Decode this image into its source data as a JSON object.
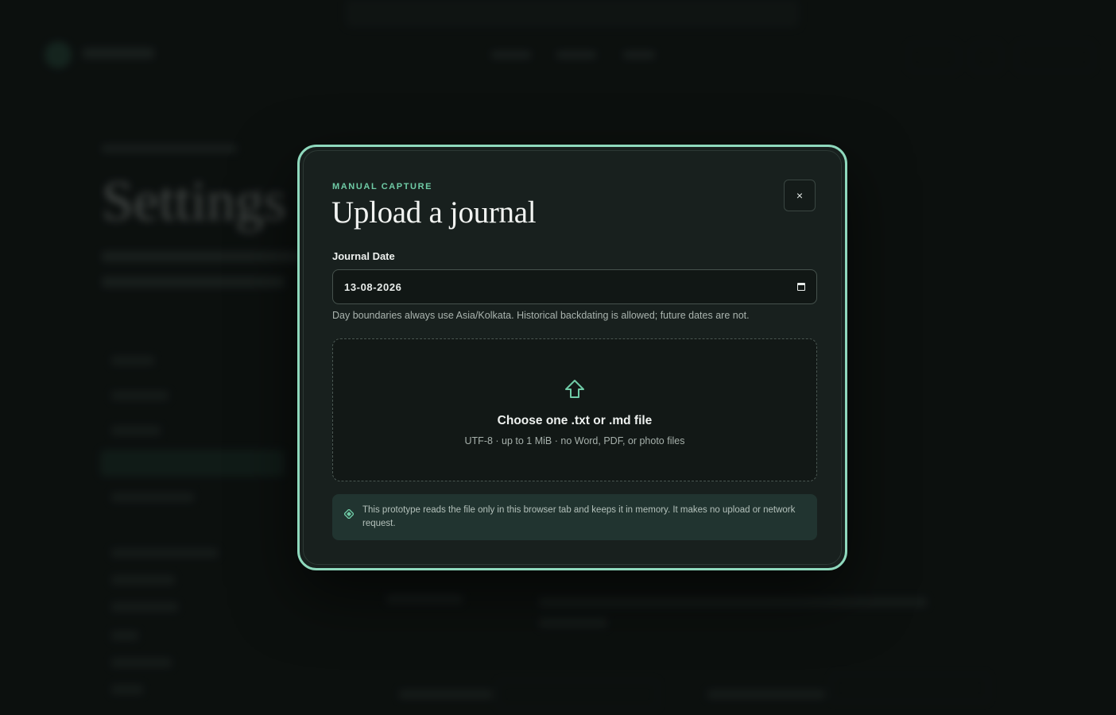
{
  "background": {
    "heading": "Settings"
  },
  "modal": {
    "eyebrow": "MANUAL CAPTURE",
    "title": "Upload a journal",
    "close_label": "×",
    "date_field": {
      "label": "Journal Date",
      "value": "13-08-2026"
    },
    "hint": "Day boundaries always use Asia/Kolkata. Historical backdating is allowed; future dates are not.",
    "dropzone": {
      "icon": "upload-arrow-icon",
      "title": "Choose one .txt or .md file",
      "subtitle": "UTF-8 · up to 1 MiB · no Word, PDF, or photo files"
    },
    "notice": {
      "icon": "diamond-icon",
      "text": "This prototype reads the file only in this browser tab and keeps it in memory. It makes no upload or network request."
    }
  },
  "colors": {
    "accent": "#6fcba6",
    "modal_border": "#8fd9bd",
    "modal_bg": "#18201e",
    "page_bg": "#0f1412",
    "notice_bg": "#213430"
  }
}
